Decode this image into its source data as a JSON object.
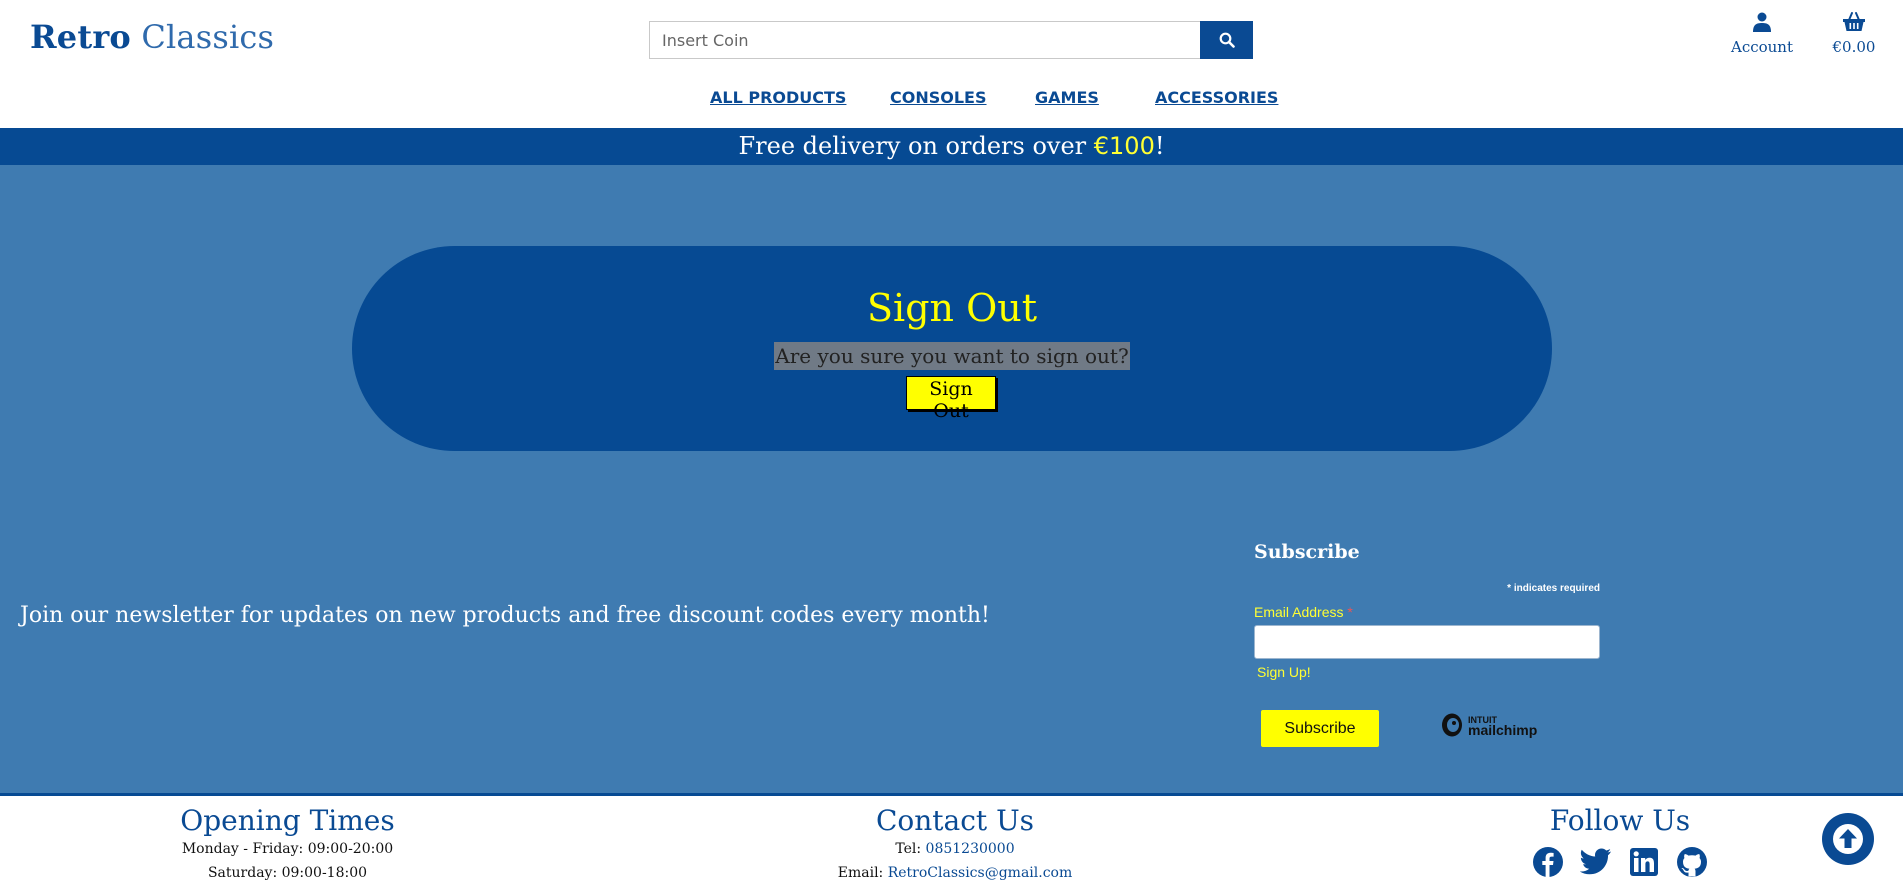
{
  "header": {
    "logo_bold": "Retro",
    "logo_light": "Classics",
    "search_placeholder": "Insert Coin",
    "account_label": "Account",
    "cart_total": "€0.00"
  },
  "nav": {
    "items": [
      "ALL PRODUCTS",
      "CONSOLES",
      "GAMES",
      "ACCESSORIES"
    ]
  },
  "banner": {
    "text": "Free delivery on orders over ",
    "amount": "€100",
    "suffix": "!"
  },
  "signout": {
    "title": "Sign Out",
    "question": "Are you sure you want to sign out?",
    "button": "Sign Out"
  },
  "newsletter": {
    "text": "Join our newsletter for updates on new products and free discount codes every month!",
    "subscribe_title": "Subscribe",
    "required_note": "indicates required",
    "required_star": "*",
    "email_label": "Email Address",
    "signup_text": "Sign Up!",
    "subscribe_button": "Subscribe",
    "mailchimp_top": "INTUIT",
    "mailchimp_bottom": "mailchimp"
  },
  "footer": {
    "opening": {
      "title": "Opening Times",
      "weekday": "Monday - Friday: 09:00-20:00",
      "saturday": "Saturday: 09:00-18:00"
    },
    "contact": {
      "title": "Contact Us",
      "tel_label": "Tel: ",
      "tel": "0851230000",
      "email_label": "Email: ",
      "email": "RetroClassics@gmail.com"
    },
    "follow": {
      "title": "Follow Us",
      "icons": [
        "facebook-icon",
        "twitter-icon",
        "linkedin-icon",
        "github-icon"
      ]
    }
  },
  "colors": {
    "brand_blue": "#064a93",
    "main_bg": "#3f7bb1",
    "accent_yellow": "#ffff00"
  }
}
